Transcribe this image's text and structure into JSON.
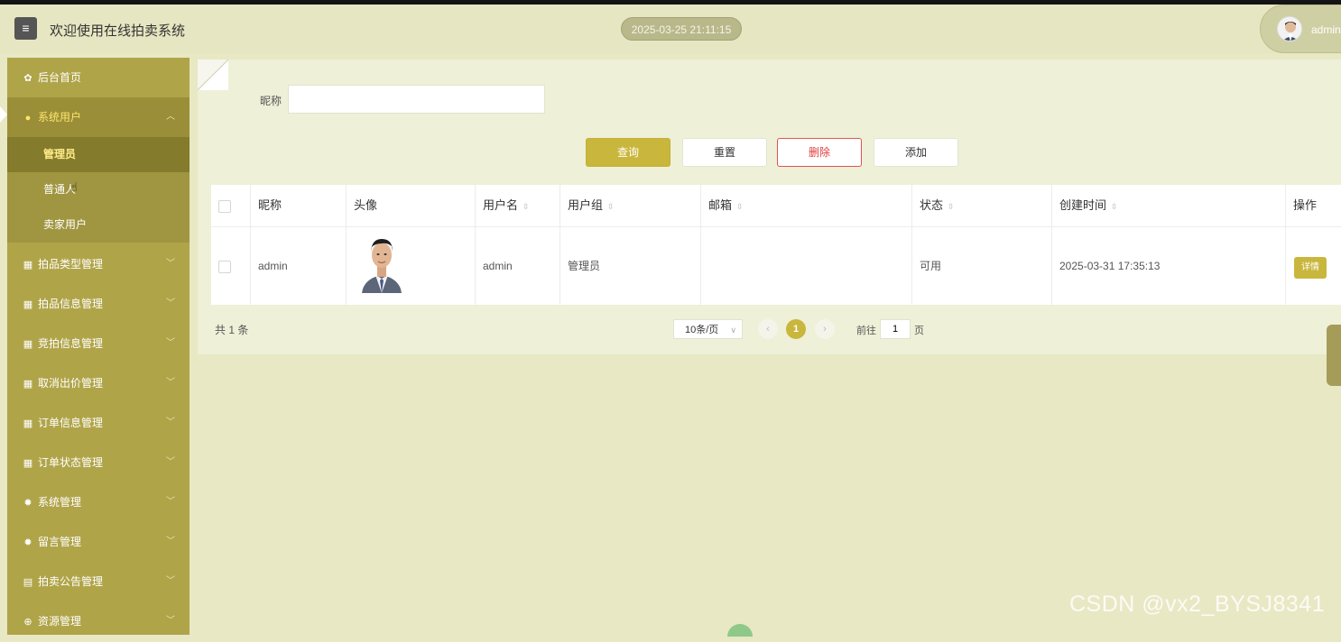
{
  "header": {
    "menu_icon": "hamburger-icon",
    "title": "欢迎使用在线拍卖系统",
    "datetime": "2025-03-25 21:11:15",
    "user_name": "admin"
  },
  "sidebar": {
    "items": [
      {
        "label": "后台首页",
        "icon": "home-icon"
      },
      {
        "label": "系统用户",
        "icon": "user-icon",
        "expanded": true,
        "children": [
          {
            "label": "管理员",
            "active": true
          },
          {
            "label": "普通人"
          },
          {
            "label": "卖家用户"
          }
        ]
      },
      {
        "label": "拍品类型管理",
        "icon": "grid-icon"
      },
      {
        "label": "拍品信息管理",
        "icon": "grid-icon"
      },
      {
        "label": "竞拍信息管理",
        "icon": "grid-icon"
      },
      {
        "label": "取消出价管理",
        "icon": "grid-icon"
      },
      {
        "label": "订单信息管理",
        "icon": "grid-icon"
      },
      {
        "label": "订单状态管理",
        "icon": "grid-icon"
      },
      {
        "label": "系统管理",
        "icon": "gear-icon"
      },
      {
        "label": "留言管理",
        "icon": "gear-icon"
      },
      {
        "label": "拍卖公告管理",
        "icon": "document-icon"
      },
      {
        "label": "资源管理",
        "icon": "plus-circle-icon"
      }
    ]
  },
  "search": {
    "label": "昵称",
    "value": ""
  },
  "buttons": {
    "query": "查询",
    "reset": "重置",
    "delete": "删除",
    "add": "添加"
  },
  "table": {
    "columns": [
      "昵称",
      "头像",
      "用户名",
      "用户组",
      "邮箱",
      "状态",
      "创建时间",
      "操作"
    ],
    "rows": [
      {
        "nickname": "admin",
        "username": "admin",
        "group": "管理员",
        "email": "",
        "status": "可用",
        "created": "2025-03-31 17:35:13",
        "action": "详情"
      }
    ]
  },
  "pagination": {
    "total": "共 1 条",
    "page_size": "10条/页",
    "current_page": "1",
    "goto_prefix": "前往",
    "goto_value": "1",
    "goto_suffix": "页"
  },
  "watermark": "CSDN @vx2_BYSJ8341",
  "colors": {
    "accent": "#c9b63c",
    "sidebar": "#b0a449",
    "danger": "#e03c3c"
  }
}
